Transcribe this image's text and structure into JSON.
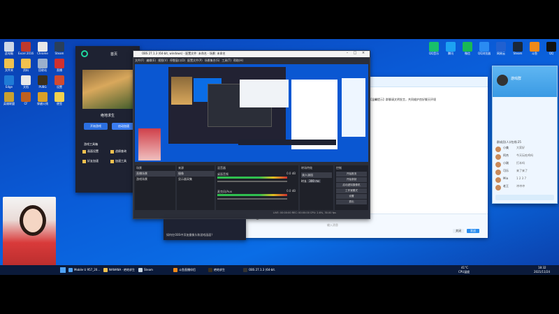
{
  "desktop_icons_left": [
    {
      "label": "此电脑",
      "color": "#cfd8e6"
    },
    {
      "label": "Excel 2016",
      "color": "#c0392b"
    },
    {
      "label": "Chrome",
      "color": "#e8e8e8"
    },
    {
      "label": "Steam",
      "color": "#2a3f5a"
    },
    {
      "label": "文件夹",
      "color": "#f2c14e"
    },
    {
      "label": "资料",
      "color": "#f2c14e"
    },
    {
      "label": "回收站",
      "color": "#9bb0cc"
    },
    {
      "label": "直播",
      "color": "#d0302f"
    },
    {
      "label": "Edge",
      "color": "#1f7bd6"
    },
    {
      "label": "文档",
      "color": "#e8e8e8"
    },
    {
      "label": "PUBG",
      "color": "#3a2f1c"
    },
    {
      "label": "设置",
      "color": "#d04a2f"
    },
    {
      "label": "英雄联盟",
      "color": "#c8a030"
    },
    {
      "label": "CF",
      "color": "#c06020"
    },
    {
      "label": "穿越火线",
      "color": "#d9a028"
    },
    {
      "label": "便签",
      "color": "#f2d14e"
    }
  ],
  "desktop_icons_right": [
    {
      "label": "QQ音乐",
      "color": "#18c06a"
    },
    {
      "label": "腾讯",
      "color": "#1da1f2"
    },
    {
      "label": "微信",
      "color": "#19b955"
    },
    {
      "label": "QQ浏览器",
      "color": "#2a8bf2"
    },
    {
      "label": "网易云",
      "color": "#2060d0"
    },
    {
      "label": "Steam",
      "color": "#1b2838"
    },
    {
      "label": "斗鱼",
      "color": "#f08a1a"
    },
    {
      "label": "QQ",
      "color": "#111111"
    }
  ],
  "game_launcher": {
    "back_label": "首页",
    "game_title": "绝地求生",
    "start_button": "开始游戏",
    "secondary_button": "启动加速",
    "section_title": "游戏工具箱",
    "tools": [
      "画面设置",
      "战绩查询",
      "好友加速",
      "加速工具"
    ]
  },
  "obs": {
    "title": "OBS 27.1.3 (64-bit, windows) - 配置文件: 未命名 - 场景: 未命名",
    "menu": [
      "文件(F)",
      "编辑(E)",
      "视图(V)",
      "停靠窗口(D)",
      "配置文件(P)",
      "场景集合(S)",
      "工具(T)",
      "帮助(H)"
    ],
    "panels": {
      "scenes": "场景",
      "sources": "来源",
      "mixer": "混音器",
      "transitions": "转场特效",
      "controls": "控制"
    },
    "scene_items": [
      "直播场景",
      "游戏场景"
    ],
    "source_items": [
      "摄像",
      "显示器采集"
    ],
    "mixer_tracks": [
      "桌面音频",
      "麦克风/Aux"
    ],
    "mixer_values": [
      "0.0 dB",
      "0.0 dB"
    ],
    "transition": "淡入淡出",
    "duration_label": "时长",
    "duration": "300 ms",
    "controls": [
      "开始推流",
      "开始录制",
      "启动虚拟摄像机",
      "工作室模式",
      "设置",
      "退出"
    ],
    "status": "LIVE: 00:00:00  REC: 00:00:00  CPU: 2.6%, 30.00 fps"
  },
  "chat": {
    "name": "游戏群",
    "members_title": "群成员(人)/在线:25",
    "messages": [
      {
        "name": "小美",
        "text": "大家好"
      },
      {
        "name": "阿杰",
        "text": "今天玩吃鸡吗"
      },
      {
        "name": "小刚",
        "text": "打本吗"
      },
      {
        "name": "可乐",
        "text": "来了来了"
      },
      {
        "name": "Mia",
        "text": "1 2 3 7"
      },
      {
        "name": "老王",
        "text": "冲冲冲"
      }
    ],
    "input_placeholder": "输入消息",
    "send_button": "发送",
    "close_button": "关闭"
  },
  "notice_text": "【温馨提示】群聊请文明发言，共同维护良好聊天环境",
  "bottom_bar_hint": "如何在OBS中添加摄像头和游戏画面？",
  "taskbar": {
    "items": [
      {
        "label": "Mobile U 957_20...",
        "color": "#4fa3f7"
      },
      {
        "label": "NANANA · 绝地求生",
        "color": "#f2c14e"
      },
      {
        "label": "Steam",
        "color": "#c7d5e0"
      },
      {
        "label": "斗鱼直播伴侣",
        "color": "#f08a1a"
      },
      {
        "label": "绝地求生",
        "color": "#3a2f1c"
      },
      {
        "label": "OBS 27.1.3 (64-bit...",
        "color": "#333333"
      }
    ],
    "weather": "41°C",
    "weather_note": "CPU温度",
    "time": "18:32",
    "date": "2021/11/24"
  }
}
